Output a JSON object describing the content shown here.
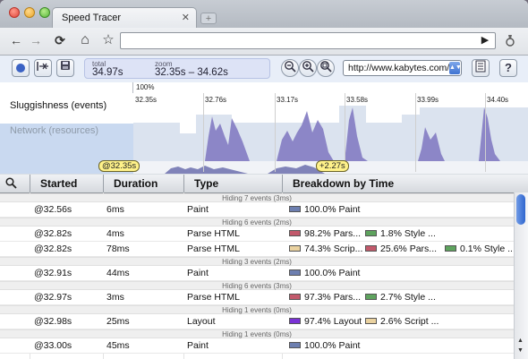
{
  "window": {
    "tab_title": "Speed Tracer",
    "tab_close": "✕",
    "new_tab": "+"
  },
  "navbar": {
    "back": "←",
    "forward": "→",
    "reload": "⟳",
    "home": "⌂",
    "star": "☆",
    "go": "▶",
    "url_value": ""
  },
  "tracer_toolbar": {
    "total_label": "total",
    "total_value": "34.97s",
    "zoom_label": "zoom",
    "zoom_value": "32.35s – 34.62s",
    "url_select_value": "http://www.kabytes.com/",
    "help": "?"
  },
  "timeline": {
    "percent_label": "100%",
    "rows": {
      "sluggishness": "Sluggishness (events)",
      "network": "Network (resources)"
    },
    "ticks": [
      "32.35s",
      "32.76s",
      "33.17s",
      "33.58s",
      "33.99s",
      "34.40s"
    ],
    "marker_left": "@32.35s",
    "marker_right": "+2.27s"
  },
  "grid": {
    "headers": {
      "started": "Started",
      "duration": "Duration",
      "type": "Type",
      "breakdown": "Breakdown by Time"
    },
    "hiding": [
      "Hiding 7 events (3ms)",
      "Hiding 6 events (2ms)",
      "Hiding 3 events (2ms)",
      "Hiding 6 events (3ms)",
      "Hiding 1 events (0ms)",
      "Hiding 1 events (0ms)"
    ],
    "rows": [
      {
        "started": "@32.56s",
        "duration": "6ms",
        "type": "Paint",
        "breakdown": [
          {
            "color": "#6d7fb0",
            "text": "100.0% Paint"
          }
        ]
      },
      {
        "started": "@32.82s",
        "duration": "4ms",
        "type": "Parse HTML",
        "breakdown": [
          {
            "color": "#c2596b",
            "text": "98.2% Pars..."
          },
          {
            "color": "#5ea35e",
            "text": "1.8% Style ..."
          }
        ]
      },
      {
        "started": "@32.82s",
        "duration": "78ms",
        "type": "Parse HTML",
        "breakdown": [
          {
            "color": "#ead2a0",
            "text": "74.3% Scrip..."
          },
          {
            "color": "#c2596b",
            "text": "25.6% Pars..."
          },
          {
            "color": "#5ea35e",
            "text": "0.1% Style ..."
          }
        ]
      },
      {
        "started": "@32.91s",
        "duration": "44ms",
        "type": "Paint",
        "breakdown": [
          {
            "color": "#6d7fb0",
            "text": "100.0% Paint"
          }
        ]
      },
      {
        "started": "@32.97s",
        "duration": "3ms",
        "type": "Parse HTML",
        "breakdown": [
          {
            "color": "#c2596b",
            "text": "97.3% Pars..."
          },
          {
            "color": "#5ea35e",
            "text": "2.7% Style ..."
          }
        ]
      },
      {
        "started": "@32.98s",
        "duration": "25ms",
        "type": "Layout",
        "breakdown": [
          {
            "color": "#7b32d6",
            "text": "97.4% Layout"
          },
          {
            "color": "#ead2a0",
            "text": "2.6% Script ..."
          }
        ]
      },
      {
        "started": "@33.00s",
        "duration": "45ms",
        "type": "Paint",
        "breakdown": [
          {
            "color": "#6d7fb0",
            "text": "100.0% Paint"
          }
        ]
      }
    ]
  }
}
